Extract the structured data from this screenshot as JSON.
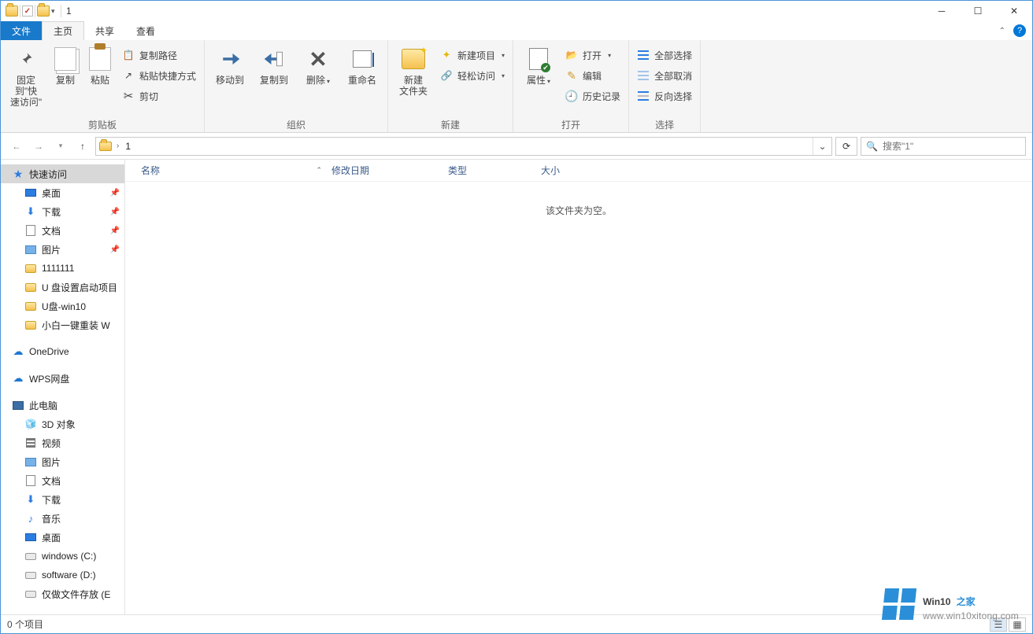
{
  "title": "1",
  "tabs": {
    "file": "文件",
    "home": "主页",
    "share": "共享",
    "view": "查看"
  },
  "ribbon": {
    "clipboard": {
      "pin": "固定到\"快\n速访问\"",
      "copy": "复制",
      "paste": "粘贴",
      "copyPath": "复制路径",
      "pasteShortcut": "粘贴快捷方式",
      "cut": "剪切",
      "label": "剪贴板"
    },
    "organize": {
      "moveTo": "移动到",
      "copyTo": "复制到",
      "delete": "删除",
      "rename": "重命名",
      "label": "组织"
    },
    "new": {
      "newFolder": "新建\n文件夹",
      "newItem": "新建项目",
      "easyAccess": "轻松访问",
      "label": "新建"
    },
    "open": {
      "properties": "属性",
      "open": "打开",
      "edit": "编辑",
      "history": "历史记录",
      "label": "打开"
    },
    "select": {
      "selectAll": "全部选择",
      "selectNone": "全部取消",
      "invert": "反向选择",
      "label": "选择"
    }
  },
  "breadcrumb": {
    "current": "1"
  },
  "search": {
    "placeholder": "搜索\"1\""
  },
  "columns": {
    "name": "名称",
    "date": "修改日期",
    "type": "类型",
    "size": "大小"
  },
  "emptyMsg": "该文件夹为空。",
  "tree": {
    "quickAccess": "快速访问",
    "pinned": [
      {
        "label": "桌面",
        "icon": "desk",
        "pin": true
      },
      {
        "label": "下载",
        "icon": "dl",
        "pin": true
      },
      {
        "label": "文档",
        "icon": "doc",
        "pin": true
      },
      {
        "label": "图片",
        "icon": "pic",
        "pin": true
      },
      {
        "label": "1111111",
        "icon": "fold"
      },
      {
        "label": "U 盘设置启动项目",
        "icon": "fold"
      },
      {
        "label": "U盘-win10",
        "icon": "fold"
      },
      {
        "label": "小白一键重装 W",
        "icon": "fold"
      }
    ],
    "oneDrive": "OneDrive",
    "wps": "WPS网盘",
    "thisPC": "此电脑",
    "pcItems": [
      {
        "label": "3D 对象",
        "icon": "cube"
      },
      {
        "label": "视频",
        "icon": "film"
      },
      {
        "label": "图片",
        "icon": "pic"
      },
      {
        "label": "文档",
        "icon": "doc"
      },
      {
        "label": "下载",
        "icon": "dl"
      },
      {
        "label": "音乐",
        "icon": "music"
      },
      {
        "label": "桌面",
        "icon": "desk"
      },
      {
        "label": "windows (C:)",
        "icon": "drive"
      },
      {
        "label": "software (D:)",
        "icon": "drive"
      },
      {
        "label": "仅做文件存放 (E",
        "icon": "drive"
      }
    ]
  },
  "status": {
    "items": "0 个项目"
  },
  "watermark": {
    "brand": "Win10",
    "suffix": "之家",
    "url": "www.win10xitong.com"
  }
}
